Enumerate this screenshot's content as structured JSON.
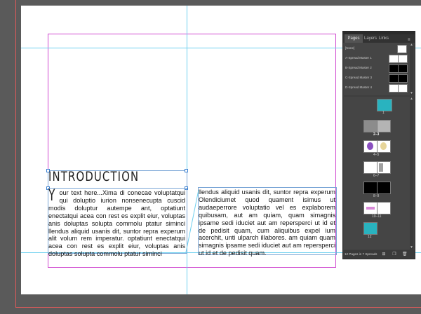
{
  "document": {
    "heading": "INTRODUCTION",
    "dropcap": "Y",
    "column1_text": "our text here...Xima di conecae voluptatqui qui doluptio iurion nonsenecupta cuscid modis doluptur autempe ant, optatiunt enectatqui acea con rest es explit eiur, voluptas anis doluptas solupta commolu ptatur siminci llendus aliquid usanis dit, suntor repra experum alit volum rem imperatur. optatiunt enectatqui acea con rest es explit eiur, voluptas anis doluptas solupta commolu ptatur siminci",
    "column2_text": "llendus aliquid usanis dit, suntor repra experum Olendiciumet quod quament isimus ut audaeperrore voluptatio vel es explaborem quibusam, aut am quiam, quam simagnis ipsame sedi iduciet aut am repersperci ut id et de pedisit quam, cum aliquibus expel ium acerchit, unti ulparch illabores. am quiam quam simagnis ipsame sedi iduciet aut am repersperci ut id et de pedisit quam."
  },
  "pages_panel": {
    "tabs": [
      "Pages",
      "Layers",
      "Links"
    ],
    "active_tab": "Pages",
    "masters": [
      "[None]",
      "A-Spread Master 1",
      "B-Spread Master 2",
      "C-Spread Master 3",
      "D-Spread Master 4"
    ],
    "page_labels": [
      "1",
      "2–3",
      "4–5",
      "6–7",
      "8–9",
      "10–11",
      "12"
    ],
    "status": "12 Pages in 7 Spreads",
    "menu_icon": "panel-menu-icon",
    "icons": [
      "page-size-icon",
      "new-page-icon",
      "delete-page-icon"
    ]
  },
  "colors": {
    "margin_guide": "#d04ad0",
    "column_guide": "#6fd0ef",
    "frame_edge": "#7aa6d6",
    "thumb_teal": "#29b3bf",
    "panel_bg": "#3f3f3f"
  }
}
